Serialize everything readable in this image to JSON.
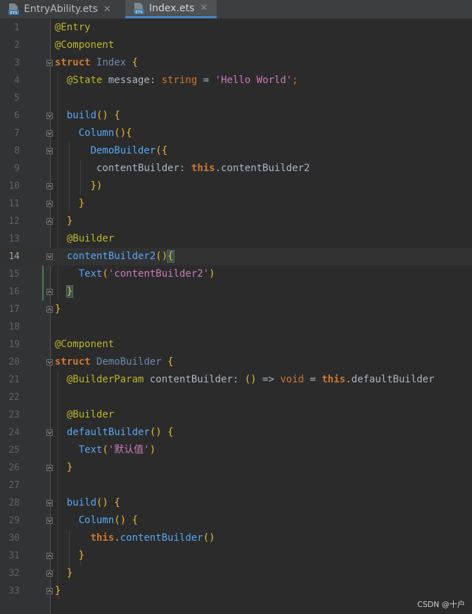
{
  "tabs": [
    {
      "label": "EntryAbility.ets",
      "icon": "ets-file-icon",
      "active": false
    },
    {
      "label": "Index.ets",
      "icon": "ets-file-icon",
      "active": true
    }
  ],
  "tab_icon_text": "ETS",
  "close_glyph": "✕",
  "colors": {
    "keyword": "#cc7832",
    "annotation": "#bbb529",
    "function": "#56a8f5",
    "string": "#c77dbb",
    "text": "#a9b7c6",
    "active_tab_underline": "#4a88c7"
  },
  "current_line": 14,
  "lines": [
    {
      "n": "1"
    },
    {
      "n": "2"
    },
    {
      "n": "3"
    },
    {
      "n": "4"
    },
    {
      "n": "5"
    },
    {
      "n": "6"
    },
    {
      "n": "7"
    },
    {
      "n": "8"
    },
    {
      "n": "9"
    },
    {
      "n": "10"
    },
    {
      "n": "11"
    },
    {
      "n": "12"
    },
    {
      "n": "13"
    },
    {
      "n": "14"
    },
    {
      "n": "15"
    },
    {
      "n": "16"
    },
    {
      "n": "17"
    },
    {
      "n": "18"
    },
    {
      "n": "19"
    },
    {
      "n": "20"
    },
    {
      "n": "21"
    },
    {
      "n": "22"
    },
    {
      "n": "23"
    },
    {
      "n": "24"
    },
    {
      "n": "25"
    },
    {
      "n": "26"
    },
    {
      "n": "27"
    },
    {
      "n": "28"
    },
    {
      "n": "29"
    },
    {
      "n": "30"
    },
    {
      "n": "31"
    },
    {
      "n": "32"
    },
    {
      "n": "33"
    }
  ],
  "code": {
    "l1": {
      "anno": "@Entry"
    },
    "l2": {
      "anno": "@Component"
    },
    "l3": {
      "kw": "struct",
      "name": "Index",
      "brace": "{"
    },
    "l4": {
      "anno": "@State",
      "ident": "message:",
      "type": "string",
      "eq": "=",
      "str": "'Hello World'",
      "semi": ";"
    },
    "l6": {
      "fn": "build",
      "paren": "()",
      "brace": "{"
    },
    "l7": {
      "fn": "Column",
      "paren": "()",
      "brace": "{"
    },
    "l8": {
      "fn": "DemoBuilder",
      "open": "({"
    },
    "l9": {
      "ident": "contentBuilder:",
      "this": "this",
      "dot": ".",
      "prop": "contentBuilder2"
    },
    "l10": {
      "close": "})"
    },
    "l11": {
      "brace": "}"
    },
    "l12": {
      "brace": "}"
    },
    "l13": {
      "anno": "@Builder"
    },
    "l14": {
      "fn": "contentBuilder2",
      "paren": "()",
      "brace": "{"
    },
    "l15": {
      "fn": "Text",
      "open": "(",
      "str": "'contentBuilder2'",
      "close": ")"
    },
    "l16": {
      "brace": "}"
    },
    "l17": {
      "brace": "}"
    },
    "l19": {
      "anno": "@Component"
    },
    "l20": {
      "kw": "struct",
      "name": "DemoBuilder",
      "brace": "{"
    },
    "l21": {
      "anno": "@BuilderParam",
      "ident": "contentBuilder:",
      "paren": "()",
      "arrow": "=>",
      "void": "void",
      "eq": "=",
      "this": "this",
      "dot": ".",
      "prop": "defaultBuilder"
    },
    "l23": {
      "anno": "@Builder"
    },
    "l24": {
      "fn": "defaultBuilder",
      "paren": "()",
      "brace": "{"
    },
    "l25": {
      "fn": "Text",
      "open": "(",
      "str": "'默认值'",
      "close": ")"
    },
    "l26": {
      "brace": "}"
    },
    "l28": {
      "fn": "build",
      "paren": "()",
      "brace": "{"
    },
    "l29": {
      "fn": "Column",
      "paren": "()",
      "brace": "{"
    },
    "l30": {
      "this": "this",
      "dot": ".",
      "fn": "contentBuilder",
      "paren": "()"
    },
    "l31": {
      "brace": "}"
    },
    "l32": {
      "brace": "}"
    },
    "l33": {
      "brace": "}"
    }
  },
  "watermark": "CSDN @十户"
}
